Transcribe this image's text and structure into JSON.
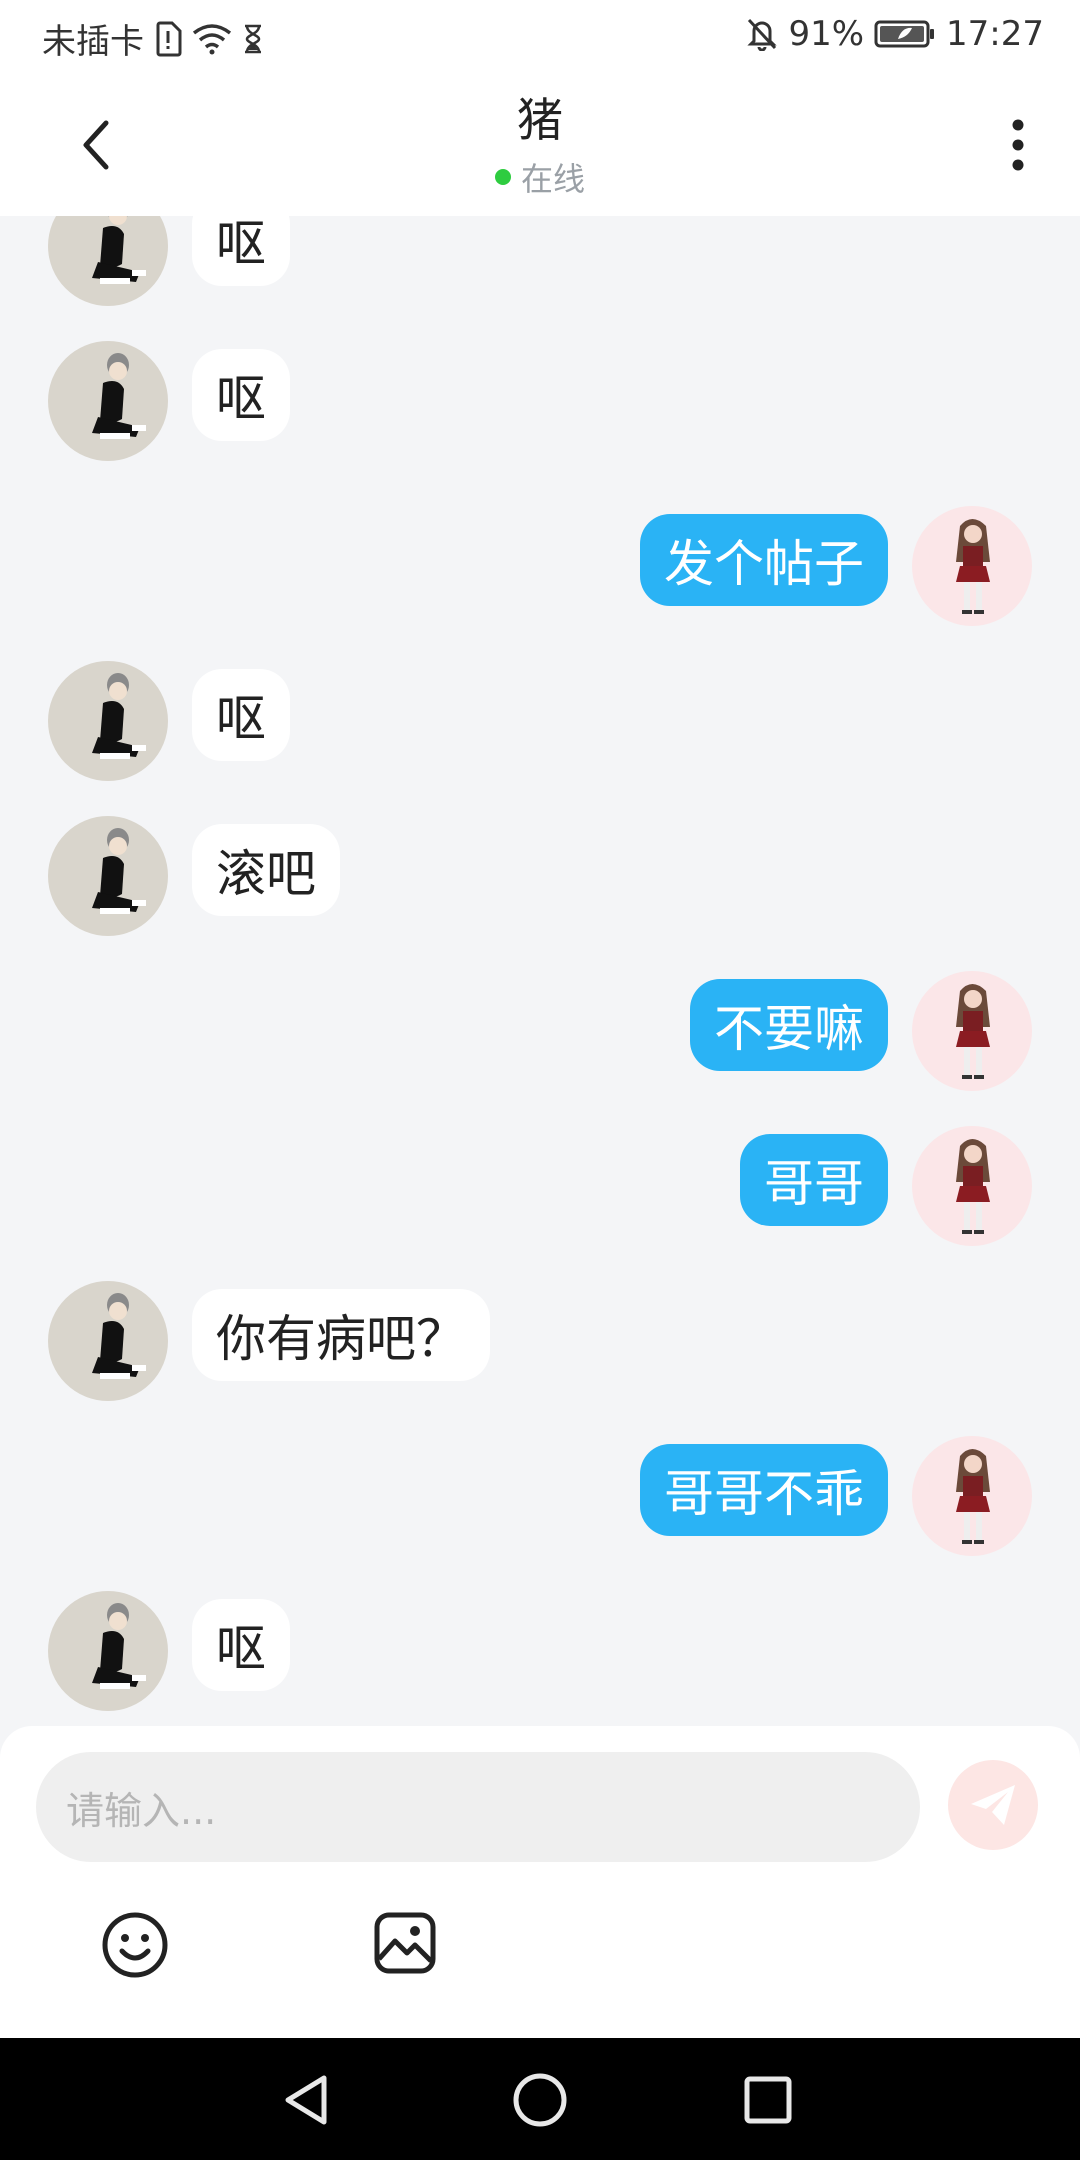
{
  "status_bar": {
    "carrier": "未插卡",
    "battery": "91%",
    "time": "17:27",
    "icons": [
      "sim-alert-icon",
      "wifi-icon",
      "hourglass-icon",
      "bell-off-icon",
      "battery-icon"
    ]
  },
  "header": {
    "title": "猪",
    "presence": "在线",
    "presence_color": "#2ecc40",
    "back_icon": "chevron-left-icon",
    "menu_icon": "more-vertical-icon"
  },
  "messages": [
    {
      "from": "other",
      "text": "呕"
    },
    {
      "from": "other",
      "text": "呕"
    },
    {
      "from": "self",
      "text": "发个帖子"
    },
    {
      "from": "other",
      "text": "呕"
    },
    {
      "from": "other",
      "text": "滚吧"
    },
    {
      "from": "self",
      "text": "不要嘛"
    },
    {
      "from": "self",
      "text": "哥哥"
    },
    {
      "from": "other",
      "text": "你有病吧？"
    },
    {
      "from": "self",
      "text": "哥哥不乖"
    },
    {
      "from": "other",
      "text": "呕"
    }
  ],
  "input": {
    "placeholder": "请输入...",
    "send_icon": "paper-plane-icon",
    "emoji_icon": "smiley-icon",
    "image_icon": "image-icon"
  },
  "colors": {
    "self_bubble": "#2ab3f5",
    "other_bubble": "#ffffff",
    "background": "#f4f5f7"
  },
  "nav_bar": {
    "icons": [
      "back-triangle-icon",
      "home-circle-icon",
      "recents-square-icon"
    ]
  }
}
